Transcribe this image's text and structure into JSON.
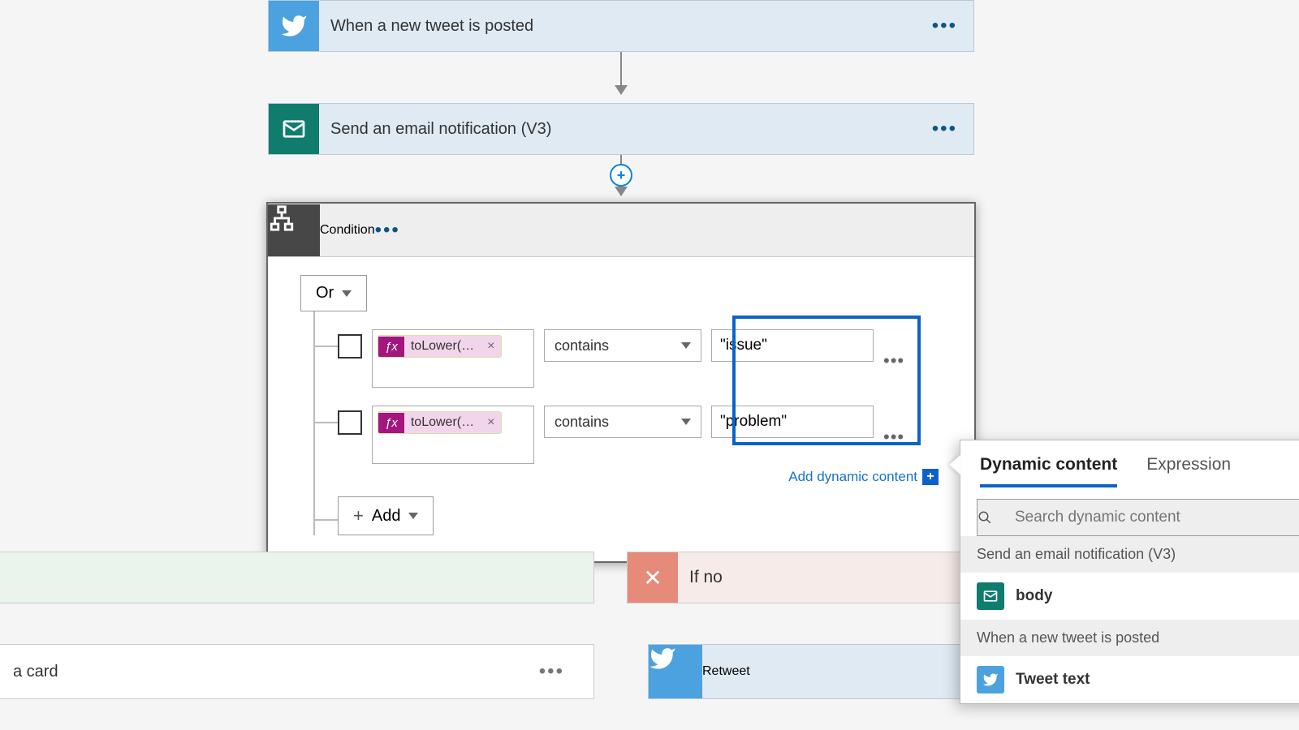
{
  "trigger": {
    "label": "When a new tweet is posted"
  },
  "action_email": {
    "label": "Send an email notification (V3)"
  },
  "condition": {
    "title": "Condition",
    "group_op": "Or",
    "rows": [
      {
        "token_label": "toLower(…",
        "operator": "contains",
        "value": "\"issue\""
      },
      {
        "token_label": "toLower(…",
        "operator": "contains",
        "value": "\"problem\""
      }
    ],
    "add_label": "Add",
    "add_dynamic_label": "Add dynamic content"
  },
  "branches": {
    "no_label": "If no",
    "yes_partial_label": "a card",
    "retweet_label": "Retweet"
  },
  "dynamic_panel": {
    "tab_dynamic": "Dynamic content",
    "tab_expression": "Expression",
    "search_placeholder": "Search dynamic content",
    "group1": "Send an email notification (V3)",
    "item1": "body",
    "group2": "When a new tweet is posted",
    "item2": "Tweet text"
  },
  "icons": {
    "twitter": "twitter-icon",
    "email": "email-icon",
    "condition": "condition-icon",
    "close": "close-icon",
    "search": "search-icon",
    "chevron": "chevron-down-icon",
    "plus": "plus-icon",
    "menu": "more-icon"
  }
}
